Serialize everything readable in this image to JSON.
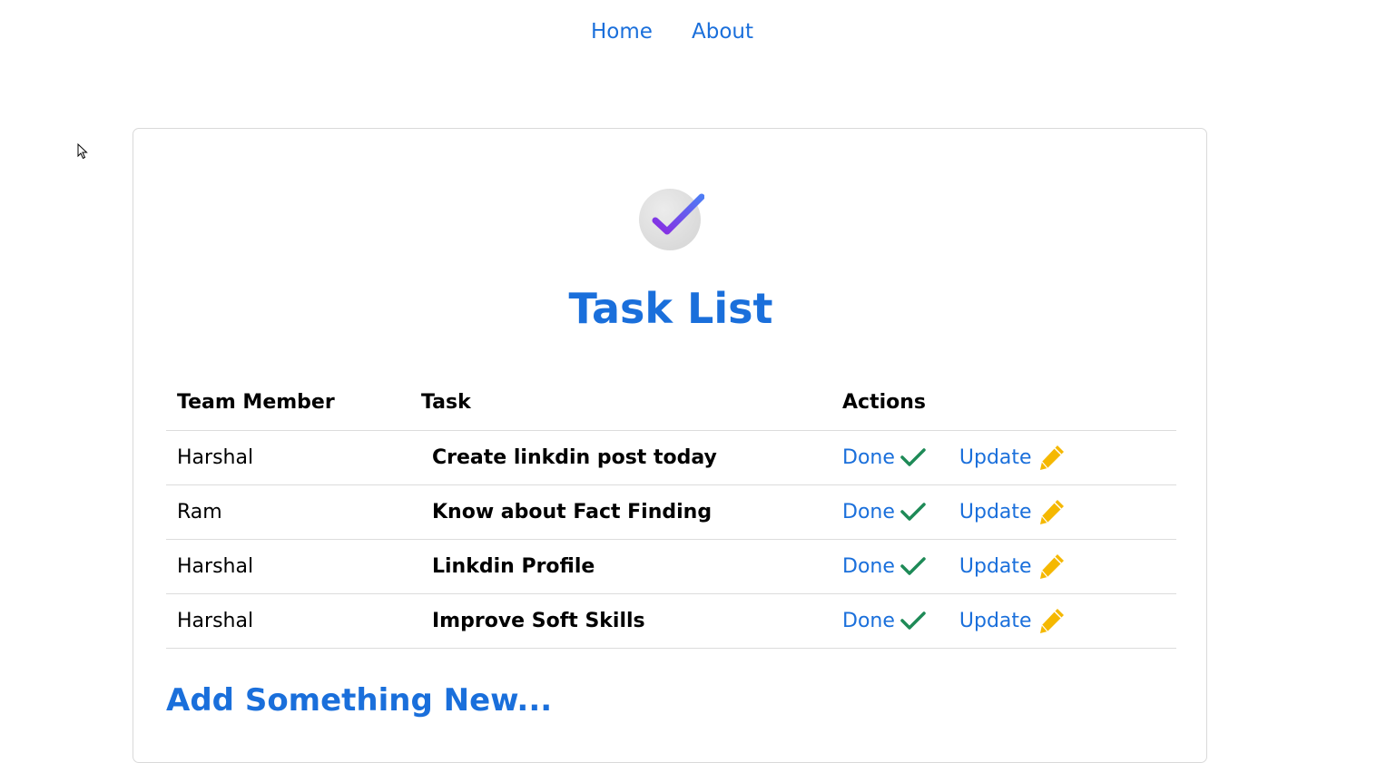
{
  "nav": {
    "links": [
      {
        "label": "Home"
      },
      {
        "label": "About"
      }
    ]
  },
  "card": {
    "logo_icon": "check-circle-icon",
    "title": "Task List",
    "table": {
      "headers": {
        "member": "Team Member",
        "task": "Task",
        "actions": "Actions"
      },
      "rows": [
        {
          "member": "Harshal",
          "task": "Create linkdin post today",
          "done_label": "Done",
          "update_label": "Update"
        },
        {
          "member": "Ram",
          "task": "Know about Fact Finding",
          "done_label": "Done",
          "update_label": "Update"
        },
        {
          "member": "Harshal",
          "task": "Linkdin Profile",
          "done_label": "Done",
          "update_label": "Update"
        },
        {
          "member": "Harshal",
          "task": "Improve Soft Skills",
          "done_label": "Done",
          "update_label": "Update"
        }
      ]
    },
    "add_new": "Add Something New..."
  },
  "colors": {
    "link": "#1a6fdb",
    "done_check": "#1e8a57",
    "update_pencil": "#f5b800",
    "logo_check": "#7b3fe4"
  }
}
